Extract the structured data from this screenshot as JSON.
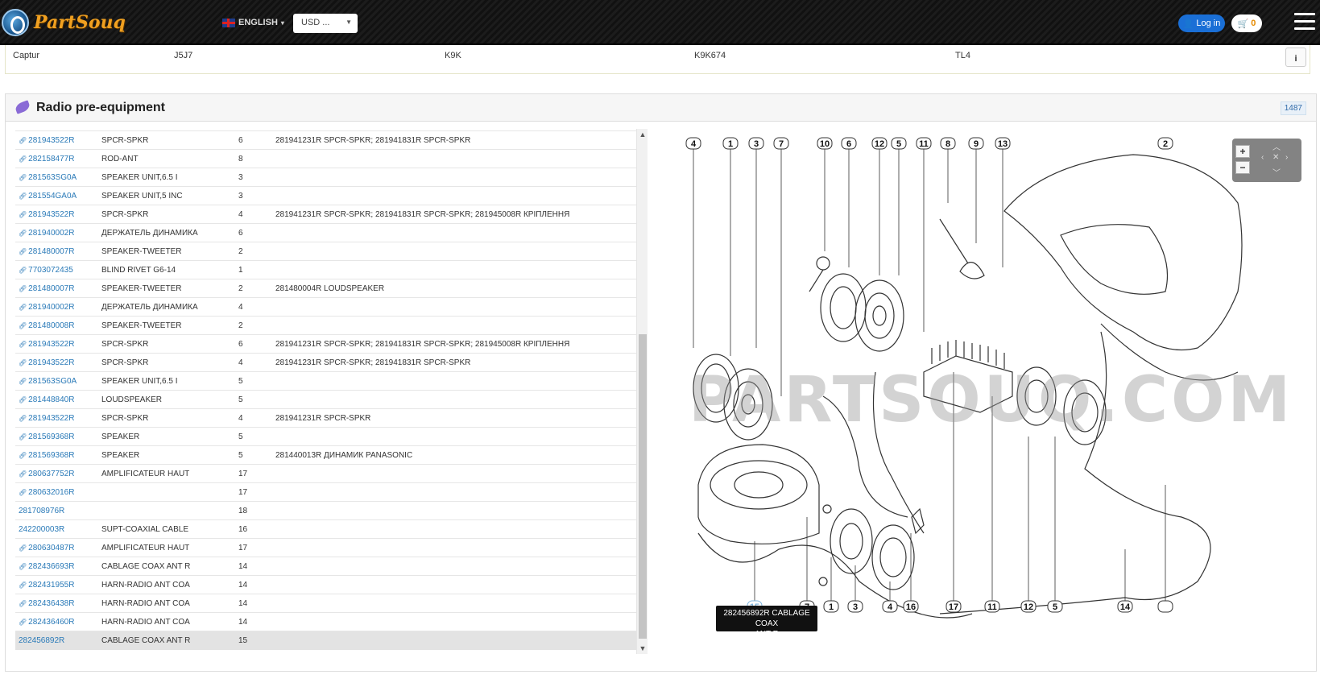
{
  "header": {
    "logo_text": "PartSouq",
    "language": "ENGLISH",
    "currency": "USD ...",
    "login_label": "Log in",
    "cart_count": "0"
  },
  "vehicle": {
    "model": "Captur",
    "code": "J5J7",
    "engine": "K9K",
    "engine_code": "K9K674",
    "gearbox": "TL4"
  },
  "panel": {
    "title": "Radio pre-equipment",
    "badge": "1487"
  },
  "parts": [
    {
      "code": "281943522R",
      "name": "SPCR-SPKR",
      "qty": "6",
      "note": "281941231R SPCR-SPKR; 281941831R SPCR-SPKR",
      "link": true
    },
    {
      "code": "282158477R",
      "name": "ROD-ANT",
      "qty": "8",
      "note": "",
      "link": true
    },
    {
      "code": "281563SG0A",
      "name": "SPEAKER UNIT,6.5 I",
      "qty": "3",
      "note": "",
      "link": true
    },
    {
      "code": "281554GA0A",
      "name": "SPEAKER UNIT,5 INC",
      "qty": "3",
      "note": "",
      "link": true
    },
    {
      "code": "281943522R",
      "name": "SPCR-SPKR",
      "qty": "4",
      "note": "281941231R SPCR-SPKR; 281941831R SPCR-SPKR; 281945008R КРІПЛЕННЯ",
      "link": true
    },
    {
      "code": "281940002R",
      "name": "ДЕРЖАТЕЛЬ ДИНАМИКА",
      "qty": "6",
      "note": "",
      "link": true
    },
    {
      "code": "281480007R",
      "name": "SPEAKER-TWEETER",
      "qty": "2",
      "note": "",
      "link": true
    },
    {
      "code": "7703072435",
      "name": "BLIND RIVET G6-14",
      "qty": "1",
      "note": "",
      "link": true
    },
    {
      "code": "281480007R",
      "name": "SPEAKER-TWEETER",
      "qty": "2",
      "note": "281480004R LOUDSPEAKER",
      "link": true
    },
    {
      "code": "281940002R",
      "name": "ДЕРЖАТЕЛЬ ДИНАМИКА",
      "qty": "4",
      "note": "",
      "link": true
    },
    {
      "code": "281480008R",
      "name": "SPEAKER-TWEETER",
      "qty": "2",
      "note": "",
      "link": true
    },
    {
      "code": "281943522R",
      "name": "SPCR-SPKR",
      "qty": "6",
      "note": "281941231R SPCR-SPKR; 281941831R SPCR-SPKR; 281945008R КРІПЛЕННЯ",
      "link": true
    },
    {
      "code": "281943522R",
      "name": "SPCR-SPKR",
      "qty": "4",
      "note": "281941231R SPCR-SPKR; 281941831R SPCR-SPKR",
      "link": true
    },
    {
      "code": "281563SG0A",
      "name": "SPEAKER UNIT,6.5 I",
      "qty": "5",
      "note": "",
      "link": true
    },
    {
      "code": "281448840R",
      "name": "LOUDSPEAKER",
      "qty": "5",
      "note": "",
      "link": true
    },
    {
      "code": "281943522R",
      "name": "SPCR-SPKR",
      "qty": "4",
      "note": "281941231R SPCR-SPKR",
      "link": true
    },
    {
      "code": "281569368R",
      "name": "SPEAKER",
      "qty": "5",
      "note": "",
      "link": true
    },
    {
      "code": "281569368R",
      "name": "SPEAKER",
      "qty": "5",
      "note": "281440013R ДИНАМИК PANASONIC",
      "link": true
    },
    {
      "code": "280637752R",
      "name": "AMPLIFICATEUR HAUT",
      "qty": "17",
      "note": "",
      "link": true
    },
    {
      "code": "280632016R",
      "name": "",
      "qty": "17",
      "note": "",
      "link": true
    },
    {
      "code": "281708976R",
      "name": "",
      "qty": "18",
      "note": "",
      "link": false
    },
    {
      "code": "242200003R",
      "name": "SUPT-COAXIAL CABLE",
      "qty": "16",
      "note": "",
      "link": false
    },
    {
      "code": "280630487R",
      "name": "AMPLIFICATEUR HAUT",
      "qty": "17",
      "note": "",
      "link": true
    },
    {
      "code": "282436693R",
      "name": "CABLAGE COAX ANT R",
      "qty": "14",
      "note": "",
      "link": true
    },
    {
      "code": "282431955R",
      "name": "HARN-RADIO ANT COA",
      "qty": "14",
      "note": "",
      "link": true
    },
    {
      "code": "282436438R",
      "name": "HARN-RADIO ANT COA",
      "qty": "14",
      "note": "",
      "link": true
    },
    {
      "code": "282436460R",
      "name": "HARN-RADIO ANT COA",
      "qty": "14",
      "note": "",
      "link": true
    },
    {
      "code": "282456892R",
      "name": "CABLAGE COAX ANT R",
      "qty": "15",
      "note": "",
      "link": false,
      "selected": true
    }
  ],
  "diagram": {
    "watermark": "PARTSOUQ.COM",
    "tooltip_line1": "282456892R CABLAGE COAX",
    "tooltip_line2": "ANT R",
    "top_callouts": [
      "4",
      "1",
      "3",
      "7",
      "10",
      "6",
      "12",
      "5",
      "11",
      "8",
      "9",
      "13",
      "2"
    ],
    "bottom_callouts": [
      "18",
      "15",
      "7",
      "1",
      "3",
      "4",
      "16",
      "17",
      "11",
      "12",
      "5",
      "14",
      ""
    ]
  },
  "zoom": {
    "plus": "+",
    "minus": "−"
  },
  "colors": {
    "link": "#2a7ab8",
    "header_bg": "#111111",
    "login": "#1a6fd6",
    "cart_count": "#e58a00"
  }
}
